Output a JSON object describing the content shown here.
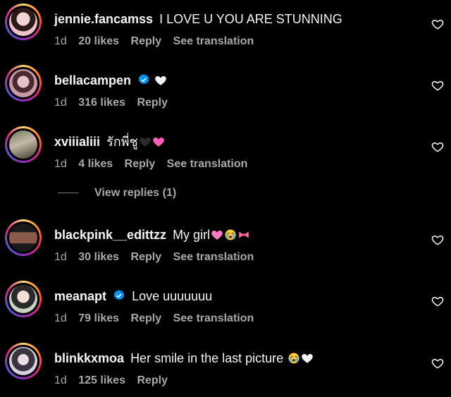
{
  "comments": [
    {
      "username": "jennie.fancamss",
      "verified": false,
      "text": "I LOVE U YOU ARE STUNNING",
      "emoji": [],
      "time": "1d",
      "likes": "20 likes",
      "reply": "Reply",
      "translate": "See translation"
    },
    {
      "username": "bellacampen",
      "verified": true,
      "text": "",
      "emoji": [
        "white-heart"
      ],
      "time": "1d",
      "likes": "316 likes",
      "reply": "Reply",
      "translate": ""
    },
    {
      "username": "xviiialiii",
      "verified": false,
      "text": "รักพี่ชู",
      "emoji": [
        "black-heart",
        "pink-heart"
      ],
      "time": "1d",
      "likes": "4 likes",
      "reply": "Reply",
      "translate": "See translation"
    },
    {
      "username": "blackpink__edittzz",
      "verified": false,
      "text": "My girl",
      "emoji": [
        "sparkling-heart",
        "crying-face",
        "ribbon"
      ],
      "time": "1d",
      "likes": "30 likes",
      "reply": "Reply",
      "translate": "See translation"
    },
    {
      "username": "meanapt",
      "verified": true,
      "text": "Love uuuuuuu",
      "emoji": [],
      "time": "1d",
      "likes": "79 likes",
      "reply": "Reply",
      "translate": "See translation"
    },
    {
      "username": "blinkkxmoa",
      "verified": false,
      "text": "Her smile in the last picture",
      "emoji": [
        "crying-face",
        "white-heart"
      ],
      "time": "1d",
      "likes": "125 likes",
      "reply": "Reply",
      "translate": ""
    }
  ],
  "view_replies": "View replies (1)",
  "colors": {
    "background": "#000000",
    "text": "#f5f5f5",
    "secondary": "#a8a8a8",
    "verified": "#0095f6"
  }
}
